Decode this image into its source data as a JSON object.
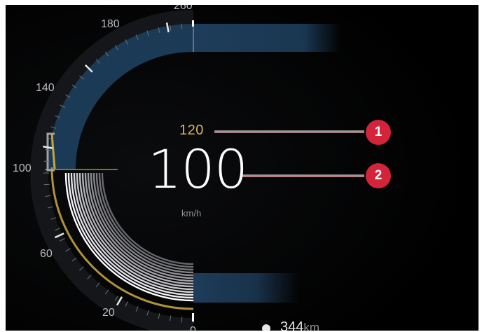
{
  "gauge": {
    "tick_labels": [
      "260",
      "180",
      "140",
      "100",
      "60",
      "20",
      "0"
    ],
    "set_speed": "120",
    "current_speed": "100",
    "unit": "km/h",
    "current_speed_value": 100,
    "set_speed_value": 120
  },
  "callouts": {
    "marker_1": "1",
    "marker_2": "2"
  },
  "range": {
    "value": "344",
    "unit": "km"
  },
  "colors": {
    "background": "#000000",
    "needle_yellow": "#c9a640",
    "blue_band": "#1c3b57",
    "callout_red": "#d3243a",
    "set_speed_gold": "#d9b25a"
  }
}
